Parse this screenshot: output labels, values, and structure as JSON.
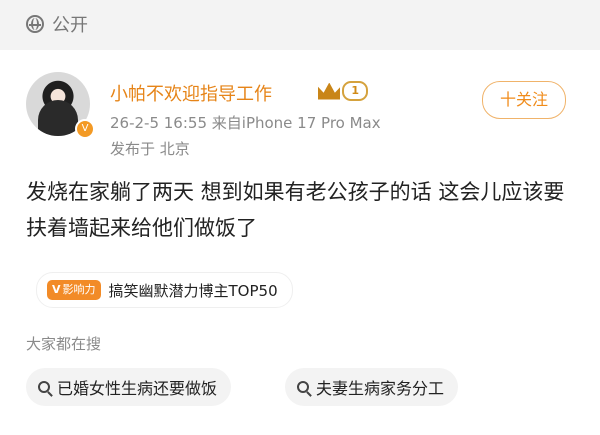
{
  "visibility": {
    "label": "公开"
  },
  "post": {
    "username": "小帕不欢迎指导工作",
    "level": "1",
    "timestamp": "26-2-5 16:55",
    "source": "来自iPhone 17 Pro Max",
    "location": "发布于 北京",
    "follow_label": "十关注",
    "text": "发烧在家躺了两天 想到如果有老公孩子的话 这会儿应该要扶着墙起来给他们做饭了",
    "tag": {
      "badge": "影响力",
      "label": "搞笑幽默潜力博主TOP50"
    }
  },
  "search": {
    "title": "大家都在搜",
    "items": [
      "已婚女性生病还要做饭",
      "夫妻生病家务分工"
    ]
  },
  "colors": {
    "accent": "#f08b1a",
    "username": "#e68418",
    "muted": "#8a8a8a"
  }
}
